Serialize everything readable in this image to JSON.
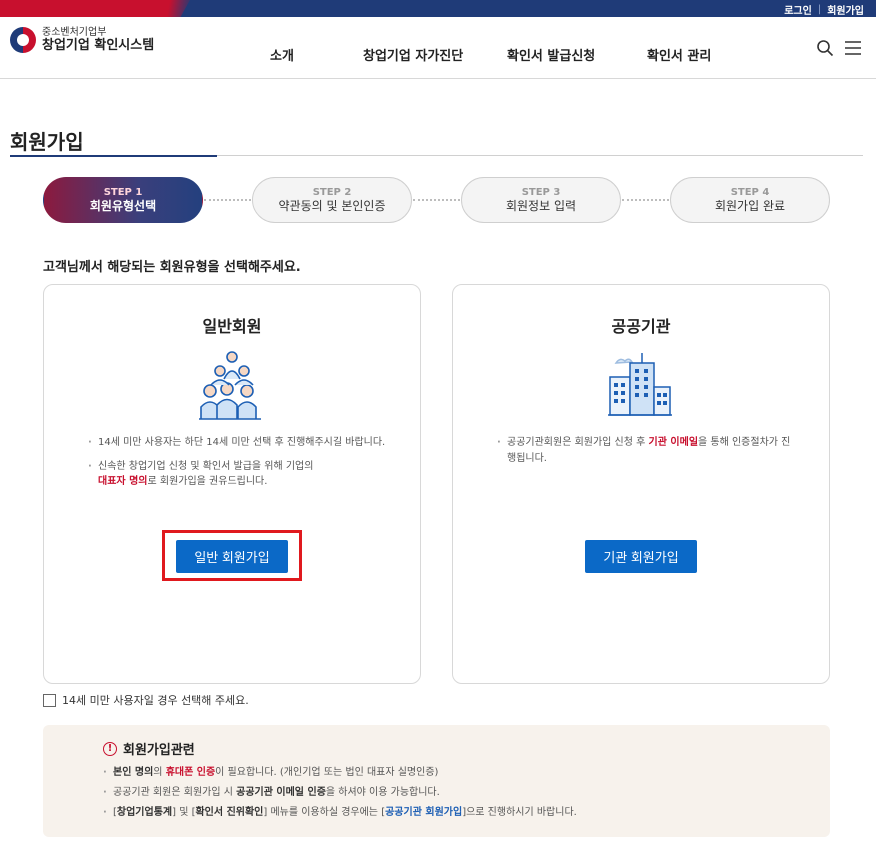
{
  "topbar": {
    "login": "로그인",
    "signup": "회원가입"
  },
  "logo": {
    "sub": "중소벤처기업부",
    "main": "창업기업 확인시스템"
  },
  "nav": [
    "소개",
    "창업기업 자가진단",
    "확인서 발급신청",
    "확인서 관리"
  ],
  "page_title": "회원가입",
  "steps": [
    {
      "num": "STEP 1",
      "label": "회원유형선택"
    },
    {
      "num": "STEP 2",
      "label": "약관동의 및 본인인증"
    },
    {
      "num": "STEP 3",
      "label": "회원정보 입력"
    },
    {
      "num": "STEP 4",
      "label": "회원가입 완료"
    }
  ],
  "lead": "고객님께서 해당되는 회원유형을 선택해주세요.",
  "general": {
    "title": "일반회원",
    "b1": "14세 미만 사용자는 하단 14세 미만 선택 후 진행해주시길 바랍니다.",
    "b2_pre": "신속한 창업기업 신청 및 확인서 발급을 위해 기업의",
    "b2_hl": "대표자 명의",
    "b2_post": "로 회원가입을 권유드립니다.",
    "button": "일반 회원가입"
  },
  "public": {
    "title": "공공기관",
    "b1_pre": "공공기관회원은 회원가입 신청 후",
    "b1_hl": "기관 이메일",
    "b1_post": "을 통해 인증절차가 진행됩니다.",
    "button": "기관 회원가입"
  },
  "under14": "14세 미만 사용자일 경우 선택해 주세요.",
  "notice": {
    "title": "회원가입관련",
    "n1_a": "본인 명의",
    "n1_b": "의 ",
    "n1_c": "휴대폰 인증",
    "n1_d": "이 필요합니다. (개인기업 또는 법인 대표자 실명인증)",
    "n2_a": "공공기관 회원은 회원가입 시 ",
    "n2_b": "공공기관 이메일 인증",
    "n2_c": "을 하셔야 이용 가능합니다.",
    "n3_a": "[",
    "n3_b": "창업기업통계",
    "n3_c": "] 및 [",
    "n3_d": "확인서 진위확인",
    "n3_e": "] 메뉴를 이용하실 경우에는 [",
    "n3_f": "공공기관 회원가입",
    "n3_g": "]으로 진행하시기 바랍니다."
  }
}
